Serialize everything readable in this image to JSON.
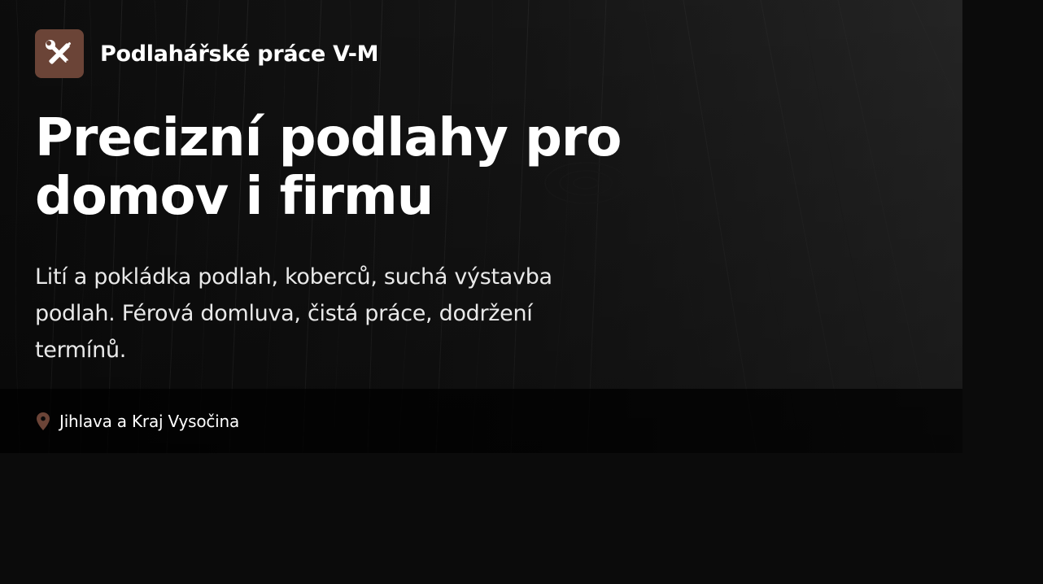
{
  "brand": {
    "name": "Podlahářské práce V-M",
    "logo_icon": "tools-icon",
    "logo_color": "#6b4437"
  },
  "hero": {
    "title": "Precizní podlahy pro domov i firmu",
    "subtitle": "Lití a pokládka podlah, koberců, suchá výstavba podlah. Férová domluva, čistá práce, dodržení termínů."
  },
  "location": {
    "icon": "map-pin-icon",
    "text": "Jihlava a Kraj Vysočina",
    "icon_color": "#6b4437"
  },
  "colors": {
    "page_background": "#0b0b0b",
    "accent": "#6b4437"
  }
}
